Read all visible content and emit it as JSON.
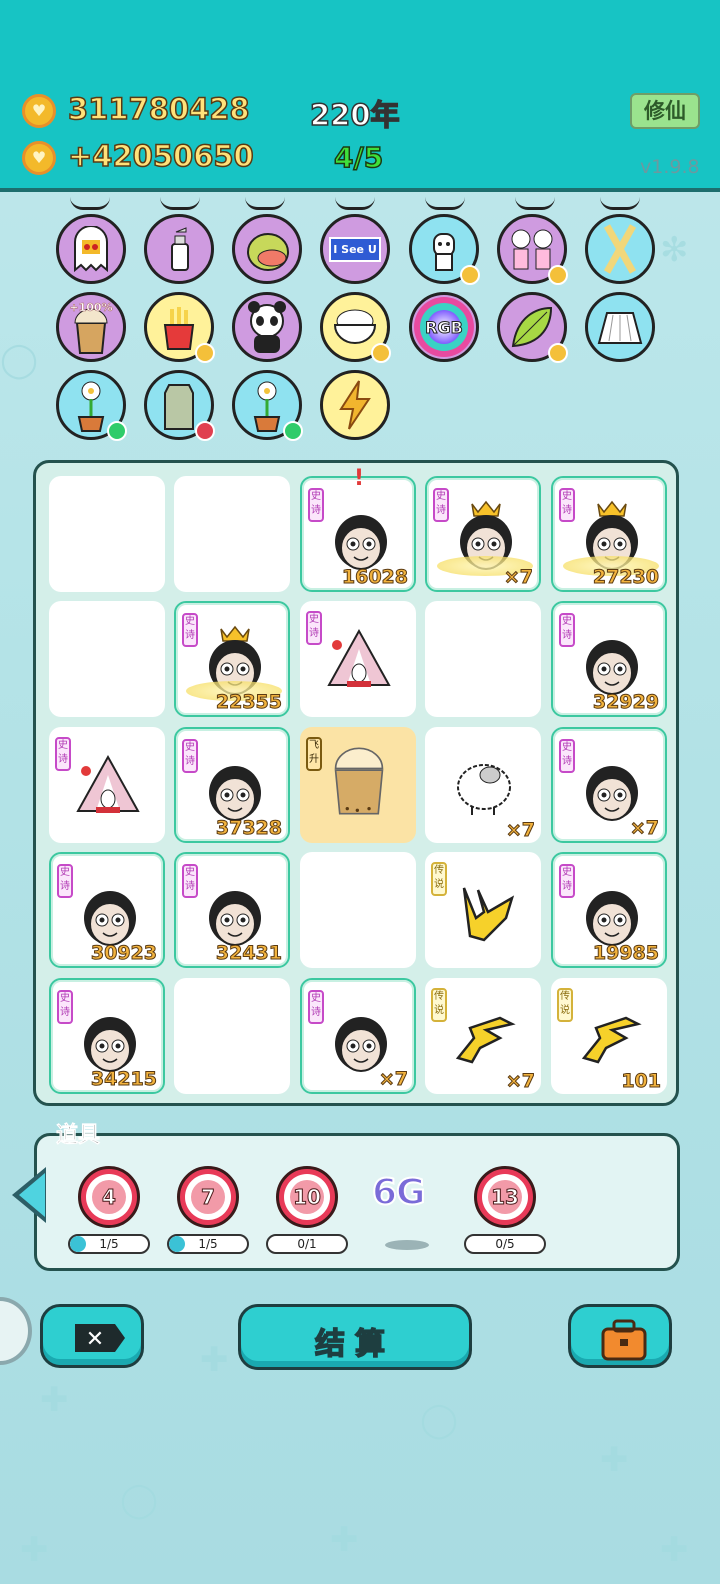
{
  "header": {
    "coins": "311780428",
    "income": "+42050650",
    "year": "220年",
    "lives": "4/5",
    "cultivate_label": "修仙",
    "version": "v1.9.8"
  },
  "items": [
    {
      "name": "ghost",
      "bg": "purple"
    },
    {
      "name": "spray-bottle",
      "bg": "purple"
    },
    {
      "name": "pomelo",
      "bg": "purple"
    },
    {
      "name": "i-see-u-sign",
      "bg": "purple",
      "text": "I See U"
    },
    {
      "name": "husky-dog",
      "bg": "cyan",
      "badge": "heart"
    },
    {
      "name": "couple-figures",
      "bg": "purple",
      "badge": "heart"
    },
    {
      "name": "crossed-sticks",
      "bg": "cyan"
    },
    {
      "name": "milk-tea-cup",
      "bg": "purple",
      "text": "+100%"
    },
    {
      "name": "french-fries",
      "bg": "yellow",
      "badge": "heart"
    },
    {
      "name": "panda",
      "bg": "purple"
    },
    {
      "name": "rice-bowl",
      "bg": "yellow",
      "badge": "heart"
    },
    {
      "name": "rgb-ball",
      "bg": "purple",
      "text": "RGB"
    },
    {
      "name": "leaf",
      "bg": "purple",
      "badge": "heart"
    },
    {
      "name": "pleated-skirt",
      "bg": "cyan"
    },
    {
      "name": "potted-flower",
      "bg": "cyan",
      "badge": "green"
    },
    {
      "name": "rice-sack",
      "bg": "cyan",
      "badge": "red"
    },
    {
      "name": "potted-flower",
      "bg": "cyan",
      "badge": "green"
    },
    {
      "name": "lightning",
      "bg": "yellow"
    }
  ],
  "board": {
    "cells": [
      {
        "type": "empty"
      },
      {
        "type": "empty"
      },
      {
        "type": "face",
        "tag": "史诗",
        "value": "16028",
        "alert": "!"
      },
      {
        "type": "face-crown",
        "tag": "史诗",
        "value": "×7"
      },
      {
        "type": "face-crown",
        "tag": "史诗",
        "value": "27230"
      },
      {
        "type": "empty"
      },
      {
        "type": "face-crown",
        "tag": "史诗",
        "value": "22355"
      },
      {
        "type": "tent",
        "tag": "史诗",
        "value": ""
      },
      {
        "type": "empty"
      },
      {
        "type": "face",
        "tag": "史诗",
        "value": "32929"
      },
      {
        "type": "tent",
        "tag": "史诗",
        "value": ""
      },
      {
        "type": "face",
        "tag": "史诗",
        "value": "37328"
      },
      {
        "type": "cup",
        "tag": "飞升",
        "value": ""
      },
      {
        "type": "sheep",
        "tag": "",
        "value": "×7"
      },
      {
        "type": "face",
        "tag": "史诗",
        "value": "×7"
      },
      {
        "type": "face",
        "tag": "史诗",
        "value": "30923"
      },
      {
        "type": "face",
        "tag": "史诗",
        "value": "32431"
      },
      {
        "type": "empty"
      },
      {
        "type": "hand",
        "tag": "传说",
        "value": ""
      },
      {
        "type": "face",
        "tag": "史诗",
        "value": "19985"
      },
      {
        "type": "face",
        "tag": "史诗",
        "value": "34215"
      },
      {
        "type": "empty"
      },
      {
        "type": "face",
        "tag": "史诗",
        "value": "×7"
      },
      {
        "type": "hand2",
        "tag": "传说",
        "value": "×7"
      },
      {
        "type": "hand2",
        "tag": "传说",
        "value": "101"
      }
    ]
  },
  "props": {
    "label": "道具",
    "items": [
      {
        "num": "4",
        "progress": "1/5",
        "fill": 0.2
      },
      {
        "num": "7",
        "progress": "1/5",
        "fill": 0.2
      },
      {
        "num": "10",
        "progress": "0/1",
        "fill": 0
      },
      {
        "special": "6G"
      },
      {
        "num": "13",
        "progress": "0/5",
        "fill": 0
      }
    ]
  },
  "buttons": {
    "settle": "结算"
  }
}
